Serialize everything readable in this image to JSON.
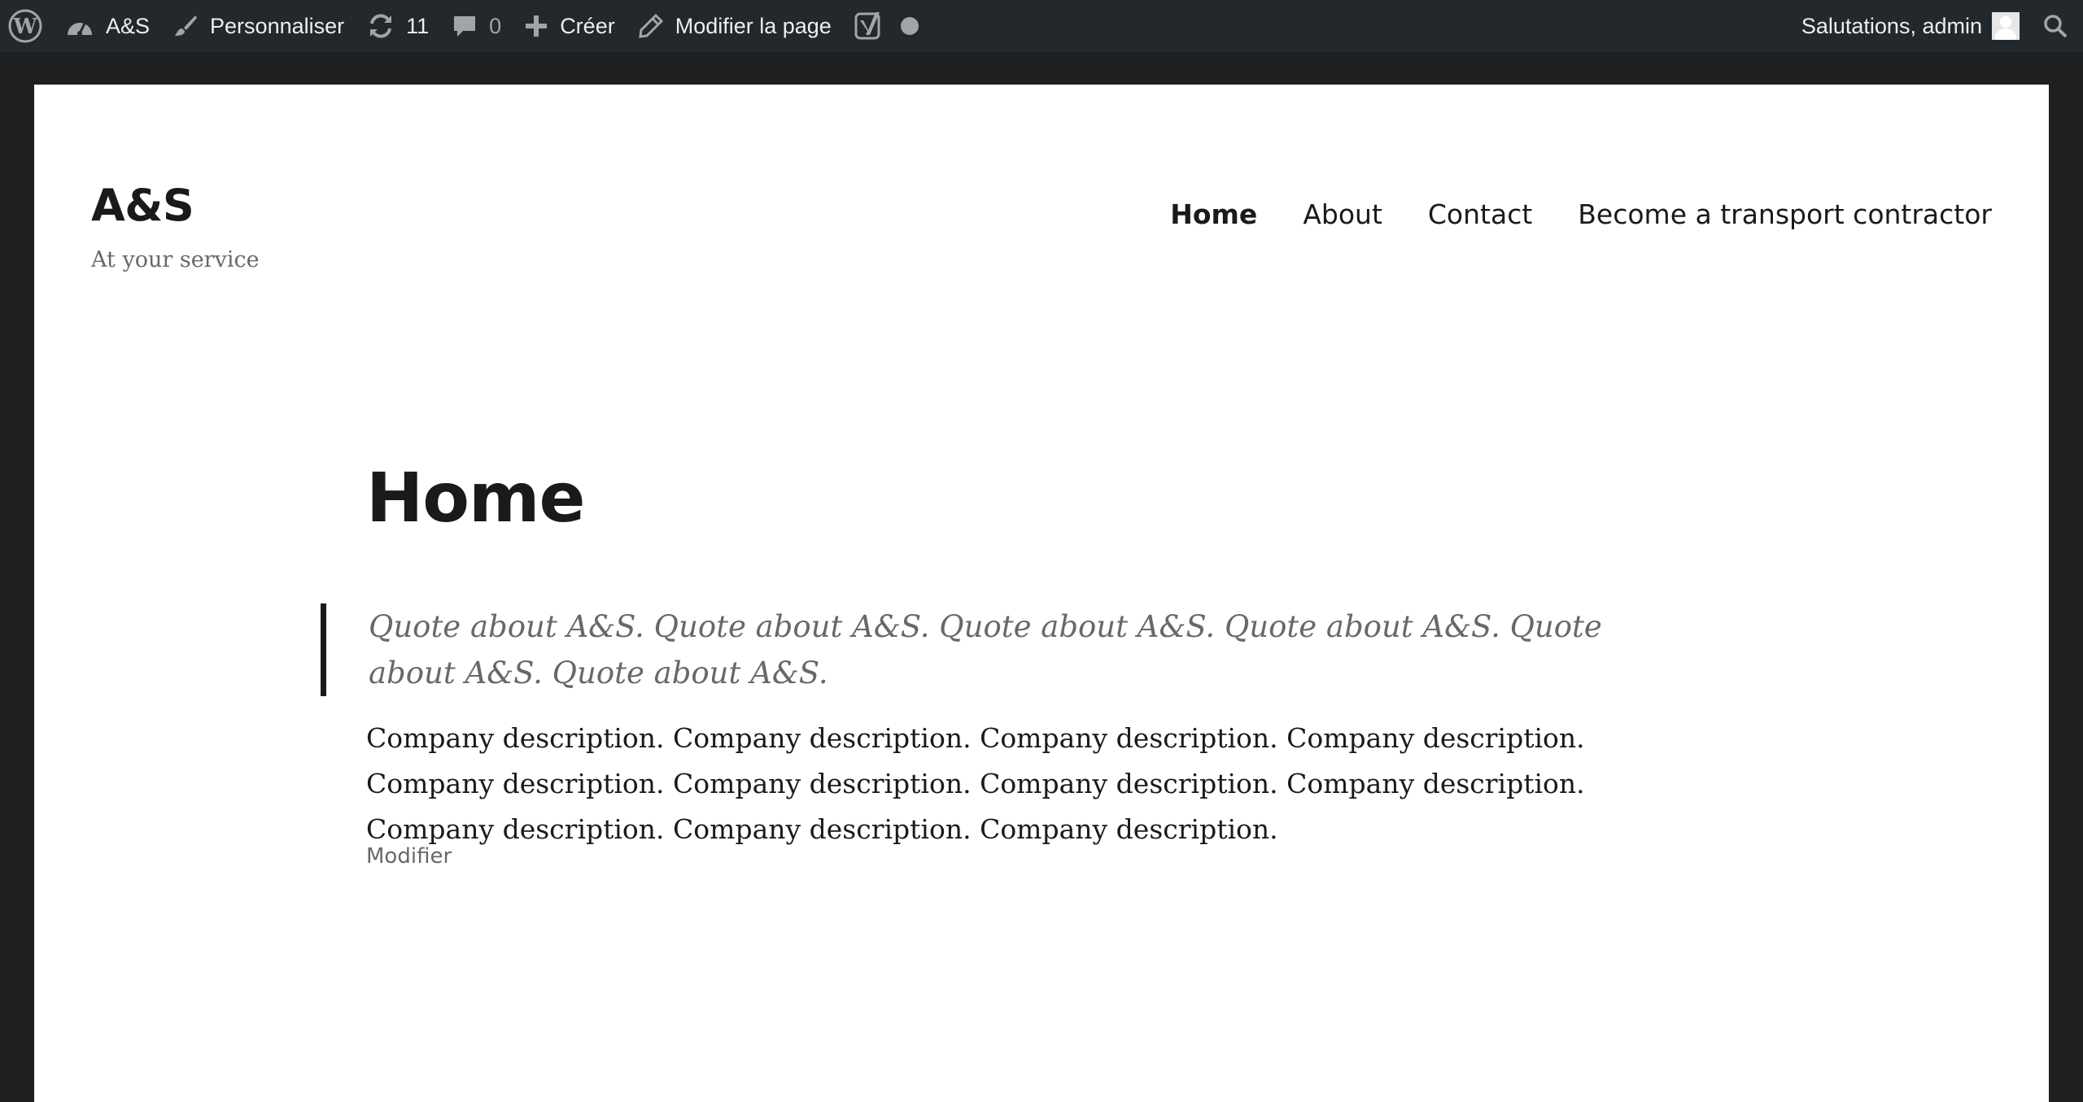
{
  "adminbar": {
    "site_name": "A&S",
    "customize_label": "Personnaliser",
    "updates_count": "11",
    "comments_count": "0",
    "new_label": "Créer",
    "edit_page_label": "Modifier la page",
    "greeting": "Salutations, admin",
    "icons": [
      "wordpress-logo-icon",
      "dashboard-icon",
      "brush-icon",
      "refresh-icon",
      "comment-icon",
      "plus-icon",
      "pencil-icon",
      "yoast-icon",
      "status-dot-icon",
      "search-icon"
    ]
  },
  "site": {
    "title": "A&S",
    "tagline": "At your service"
  },
  "nav": {
    "items": [
      {
        "label": "Home"
      },
      {
        "label": "About"
      },
      {
        "label": "Contact"
      },
      {
        "label": "Become a transport contractor"
      }
    ]
  },
  "entry": {
    "title": "Home",
    "quote": "Quote about A&S. Quote about A&S. Quote about A&S. Quote about A&S. Quote about A&S. Quote about A&S.",
    "description": "Company description. Company description. Company description. Company description. Company description. Company description. Company description. Company description. Company description. Company description. Company description.",
    "edit_label": "Modifier"
  },
  "colors": {
    "adminbar_bg": "#23282d",
    "outer_bg": "#1d1f21",
    "page_bg": "#ffffff",
    "text": "#1a1a1a",
    "muted_text": "#686868"
  }
}
